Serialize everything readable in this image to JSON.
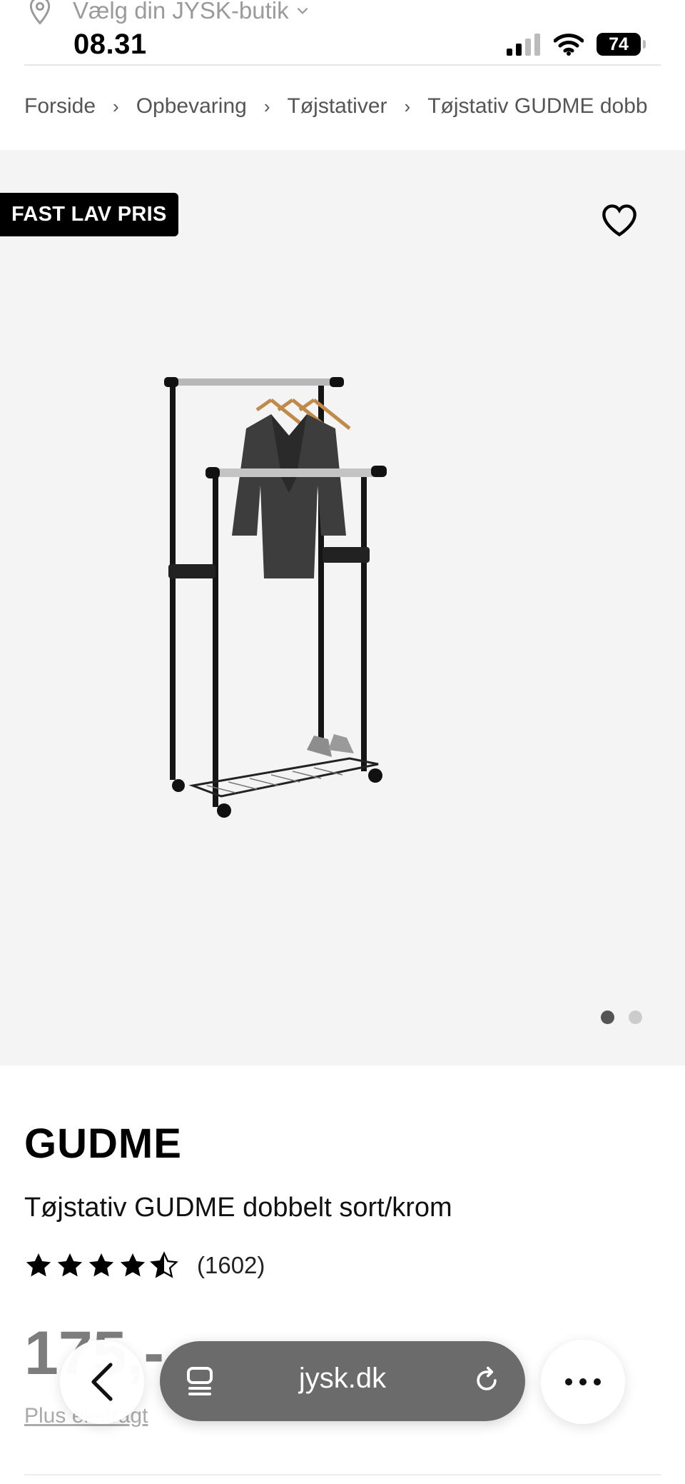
{
  "status_bar": {
    "store_label": "Vælg din JYSK-butik",
    "time": "08.31",
    "battery": "74"
  },
  "breadcrumb": [
    "Forside",
    "Opbevaring",
    "Tøjstativer",
    "Tøjstativ GUDME dobb"
  ],
  "product": {
    "badge": "FAST LAV PRIS",
    "brand": "GUDME",
    "name": "Tøjstativ GUDME dobbelt sort/krom",
    "rating": 4.5,
    "reviews": "(1602)",
    "price": "175,-",
    "plus_link": "Plus ekstragt",
    "image_count": 2,
    "active_image": 1
  },
  "browser": {
    "url": "jysk.dk"
  },
  "colors": {
    "badge_bg": "#000000",
    "hero_bg": "#f4f4f4",
    "url_pill": "#6b6b6b"
  }
}
